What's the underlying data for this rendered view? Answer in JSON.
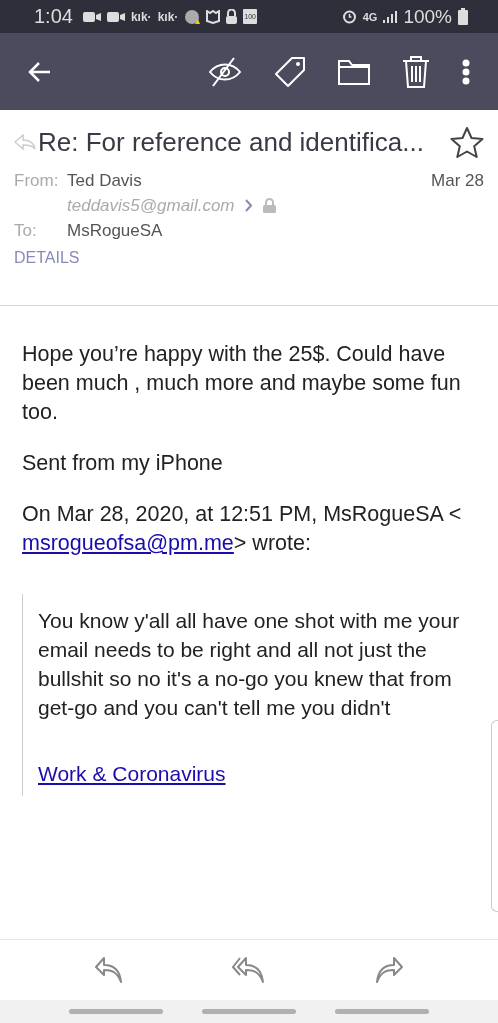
{
  "status_bar": {
    "time": "1:04",
    "app_labels": [
      "kık·",
      "kık·"
    ],
    "battery_small": "100",
    "network": "4G",
    "battery": "100%"
  },
  "email": {
    "subject": "Re: For reference and identifica...",
    "starred": false,
    "from_label": "From:",
    "from_name": "Ted Davis",
    "from_address": "teddavis5@gmail.com",
    "date": "Mar 28",
    "to_label": "To:",
    "to_name": "MsRogueSA",
    "details": "DETAILS"
  },
  "body": {
    "paragraphs": [
      "Hope you’re happy with the 25$. Could have been much , much more and maybe some fun too.",
      "Sent from my iPhone"
    ],
    "quote_intro": "On Mar 28, 2020, at 12:51 PM, MsRogueSA < ",
    "quote_link": "msrogueofsa@pm.me",
    "quote_intro_end": "> wrote:",
    "quote": "You know y'all all have one shot with me your email needs to be right and all not just the bullshit so no it's a no-go you knew that from get-go and you can't tell me you didn't",
    "quote_link_2": "Work & Coronavirus"
  }
}
